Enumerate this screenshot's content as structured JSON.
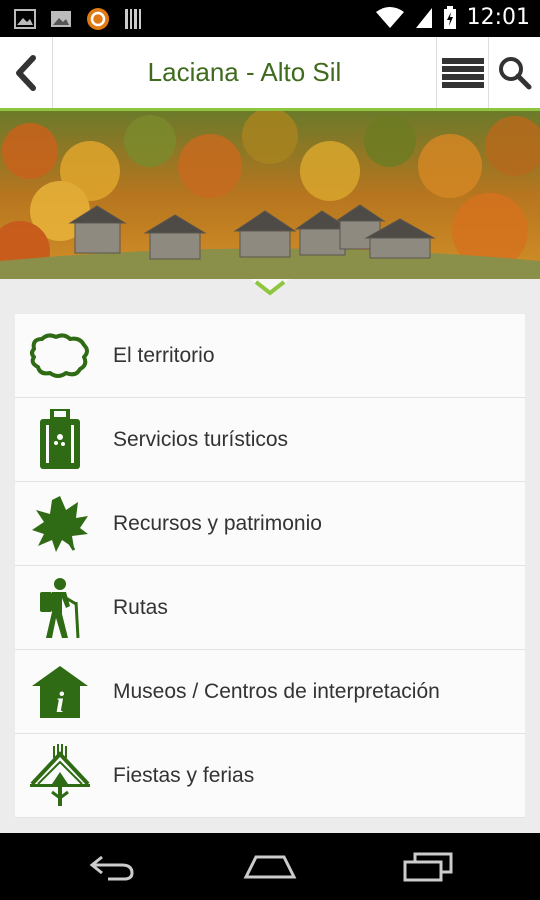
{
  "status_bar": {
    "time": "12:01",
    "icons": [
      "image-icon",
      "gallery-icon",
      "sync-app-icon",
      "barcode-icon",
      "wifi-icon",
      "signal-icon",
      "battery-icon"
    ]
  },
  "header": {
    "title": "Laciana - Alto Sil",
    "back_icon": "chevron-left-icon",
    "list_icon": "list-view-icon",
    "search_icon": "search-icon"
  },
  "colors": {
    "accent_green": "#3e6b1d",
    "icon_green": "#2f6b14",
    "header_underline": "#8ec63f"
  },
  "menu": {
    "items": [
      {
        "label": "El territorio",
        "icon": "territory-map-icon"
      },
      {
        "label": "Servicios turísticos",
        "icon": "luggage-icon"
      },
      {
        "label": "Recursos y patrimonio",
        "icon": "leaf-icon"
      },
      {
        "label": "Rutas",
        "icon": "hiker-icon"
      },
      {
        "label": "Museos / Centros de interpretación",
        "icon": "info-house-icon"
      },
      {
        "label": "Fiestas y ferias",
        "icon": "festival-arch-icon"
      }
    ]
  },
  "nav": {
    "back": "back-nav-icon",
    "home": "home-nav-icon",
    "recents": "recents-nav-icon"
  }
}
